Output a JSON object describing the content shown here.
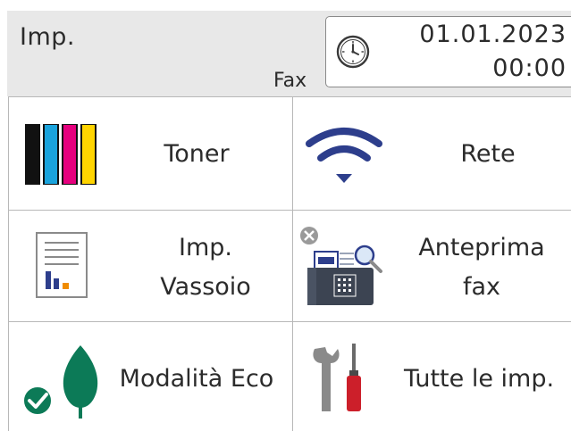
{
  "header": {
    "title": "Imp.",
    "mode": "Fax",
    "date": "01.01.2023",
    "time": "00:00",
    "clock_icon": "clock-icon"
  },
  "tiles": [
    {
      "id": "toner",
      "label": "Toner",
      "icon": "toner-bars-icon",
      "toner_colors": [
        "#111111",
        "#1aa3dc",
        "#e6007e",
        "#ffd400"
      ]
    },
    {
      "id": "rete",
      "label": "Rete",
      "icon": "wifi-icon",
      "icon_color": "#2d3e8c"
    },
    {
      "id": "vassoio",
      "line1": "Imp.",
      "line2": "Vassoio",
      "icon": "tray-report-icon"
    },
    {
      "id": "fax",
      "line1": "Anteprima",
      "line2": "fax",
      "icon": "fax-preview-icon"
    },
    {
      "id": "eco",
      "label": "Modalità Eco",
      "icon": "eco-leaf-icon",
      "icon_color": "#0c7a57"
    },
    {
      "id": "tutte",
      "label": "Tutte le imp.",
      "icon": "tools-icon",
      "accent_color": "#cc1f2a"
    }
  ]
}
